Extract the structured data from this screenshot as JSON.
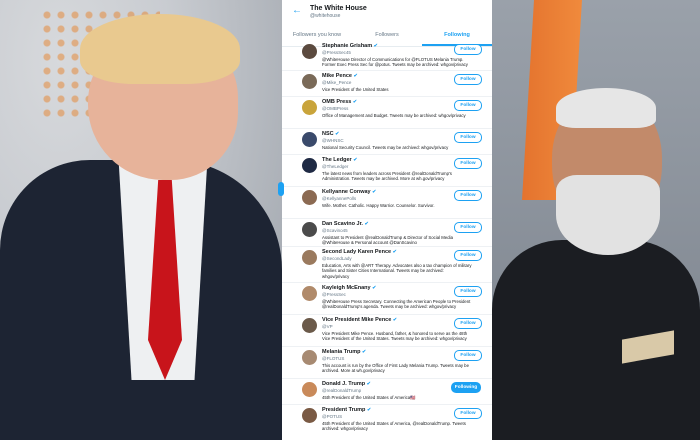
{
  "account": {
    "title": "The White House",
    "handle": "@whitehouse"
  },
  "tabs": [
    {
      "label": "Followers you know"
    },
    {
      "label": "Followers"
    },
    {
      "label": "Following"
    }
  ],
  "accounts": [
    {
      "name": "Stephanie Grisham",
      "handle": "@PressSec45",
      "bio": "@WhiteHouse Director of Communications for @FLOTUS Melania Trump. Former Exec Press Sec for @potus. Tweets may be archived: whgov/privacy",
      "button": "Follow",
      "avatar_color": "#5b4a3f"
    },
    {
      "name": "Mike Pence",
      "handle": "@Mike_Pence",
      "bio": "Vice President of the United States",
      "button": "Follow",
      "avatar_color": "#7a6a58"
    },
    {
      "name": "OMB Press",
      "handle": "@OMBPress",
      "bio": "Office of Management and Budget. Tweets may be archived: whgov/privacy",
      "button": "Follow",
      "avatar_color": "#c9a43b"
    },
    {
      "name": "NSC",
      "handle": "@WHNSC",
      "bio": "National Security Council. Tweets may be archived: whgov/privacy",
      "button": "Follow",
      "avatar_color": "#3a4a6b"
    },
    {
      "name": "The Ledger",
      "handle": "@TheLedger",
      "bio": "The latest news from leaders across President @realDonaldTrump's Administration. Tweets may be archived. More at wh.gov/privacy",
      "button": "Follow",
      "avatar_color": "#1f2a44"
    },
    {
      "name": "Kellyanne Conway",
      "handle": "@KellyannePolls",
      "bio": "Wife. Mother. Catholic. Happy Warrior. Counselor. Survivor.",
      "button": "Follow",
      "avatar_color": "#8b6a52"
    },
    {
      "name": "Dan Scavino Jr.",
      "handle": "@Scavino45",
      "bio": "Assistant to President @realDonaldTrump & Director of Social Media @WhiteHouse & Personal account @DanScavino",
      "button": "Follow",
      "avatar_color": "#4b4b4b"
    },
    {
      "name": "Second Lady Karen Pence",
      "handle": "@SecondLady",
      "bio": "Education, Arts with @ART Therapy. Advocates also a tax champion of military families and Sister Cities International. Tweets may be archived: whgov/privacy",
      "button": "Follow",
      "avatar_color": "#9a7a5e"
    },
    {
      "name": "Kayleigh McEnany",
      "handle": "@PressSec",
      "bio": "@WhiteHouse Press Secretary. Connecting the American People to President @realDonaldTrump's agenda. Tweets may be archived: whgov/privacy",
      "button": "Follow",
      "avatar_color": "#b08a6a"
    },
    {
      "name": "Vice President Mike Pence",
      "handle": "@VP",
      "bio": "Vice President Mike Pence. Husband, father, & honored to serve as the 48th Vice President of the United States. Tweets may be archived: whgov/privacy",
      "button": "Follow",
      "avatar_color": "#6b5a4a"
    },
    {
      "name": "Melania Trump",
      "handle": "@FLOTUS",
      "bio": "This account is run by the Office of First Lady Melania Trump. Tweets may be archived. More at wh.gov/privacy",
      "button": "Follow",
      "avatar_color": "#a78a72"
    },
    {
      "name": "Donald J. Trump",
      "handle": "@realDonaldTrump",
      "bio": "45th President of the United States of America🇺🇸",
      "button": "Following",
      "avatar_color": "#c98a5a"
    },
    {
      "name": "President Trump",
      "handle": "@POTUS",
      "bio": "45th President of the United States of America, @realDonaldTrump. Tweets archived: whgov/privacy",
      "button": "Follow",
      "avatar_color": "#7a5a44"
    }
  ]
}
